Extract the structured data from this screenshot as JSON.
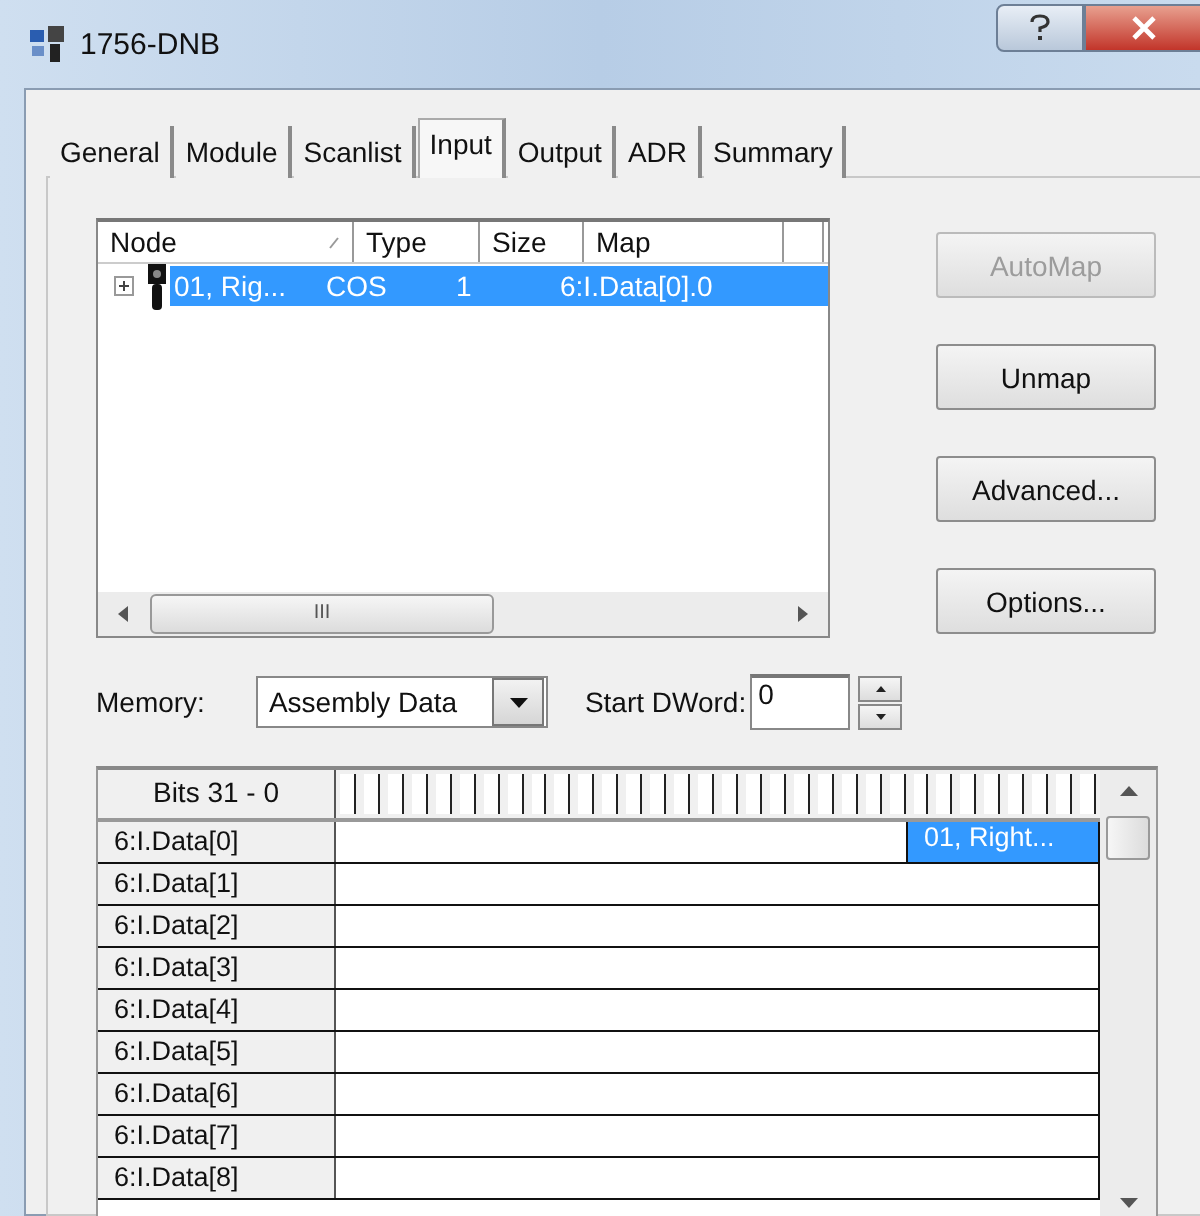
{
  "window": {
    "title": "1756-DNB"
  },
  "tabs": [
    {
      "label": "General",
      "selected": false
    },
    {
      "label": "Module",
      "selected": false
    },
    {
      "label": "Scanlist",
      "selected": false
    },
    {
      "label": "Input",
      "selected": true
    },
    {
      "label": "Output",
      "selected": false
    },
    {
      "label": "ADR",
      "selected": false
    },
    {
      "label": "Summary",
      "selected": false
    }
  ],
  "node_list": {
    "columns": [
      "Node",
      "Type",
      "Size",
      "Map"
    ],
    "rows": [
      {
        "node": "01, Rig...",
        "type": "COS",
        "size": "1",
        "map": "6:I.Data[0].0",
        "selected": true,
        "expanded": false
      }
    ],
    "scroll_grip": "III"
  },
  "buttons": [
    {
      "label": "AutoMap",
      "disabled": true
    },
    {
      "label": "Unmap",
      "disabled": false
    },
    {
      "label": "Advanced...",
      "disabled": false
    },
    {
      "label": "Options...",
      "disabled": false
    }
  ],
  "memory": {
    "label": "Memory:",
    "value": "Assembly Data"
  },
  "start_dword": {
    "label": "Start DWord:",
    "value": "0"
  },
  "bit_grid": {
    "header": "Bits 31 - 0",
    "rows": [
      {
        "label": "6:I.Data[0]",
        "mapping": "01, Right...",
        "selected": true
      },
      {
        "label": "6:I.Data[1]"
      },
      {
        "label": "6:I.Data[2]"
      },
      {
        "label": "6:I.Data[3]"
      },
      {
        "label": "6:I.Data[4]"
      },
      {
        "label": "6:I.Data[5]"
      },
      {
        "label": "6:I.Data[6]"
      },
      {
        "label": "6:I.Data[7]"
      },
      {
        "label": "6:I.Data[8]"
      }
    ]
  }
}
